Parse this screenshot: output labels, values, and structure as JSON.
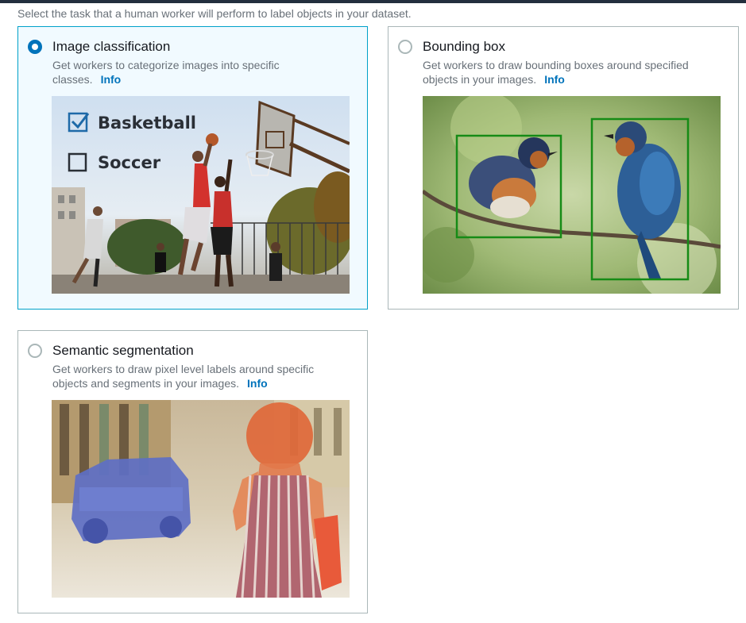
{
  "instruction": "Select the task that a human worker will perform to label objects in your dataset.",
  "colors": {
    "selected_border": "#00a1c9",
    "selected_background": "#f1faff",
    "radio_checked": "#0073bb",
    "link": "#0073bb"
  },
  "options": [
    {
      "title": "Image classification",
      "description": "Get workers to categorize images into specific classes.",
      "info": "Info",
      "selected": true,
      "preview_labels": {
        "checked": "Basketball",
        "unchecked": "Soccer"
      }
    },
    {
      "title": "Bounding box",
      "description": "Get workers to draw bounding boxes around specified objects in your images.",
      "info": "Info",
      "selected": false
    },
    {
      "title": "Semantic segmentation",
      "description": "Get workers to draw pixel level labels around specific objects and segments in your images.",
      "info": "Info",
      "selected": false
    }
  ]
}
